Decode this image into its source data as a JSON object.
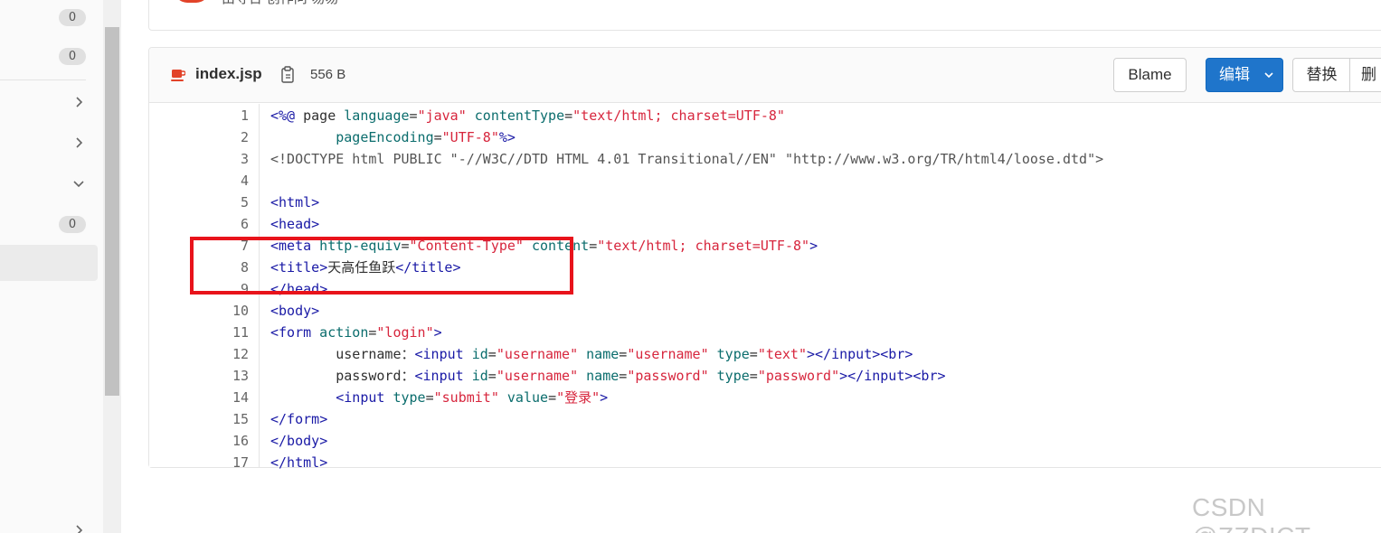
{
  "sidebar": {
    "badges": [
      "0",
      "0",
      "0"
    ],
    "chevrons": [
      "chevron-right",
      "chevron-right",
      "chevron-down",
      "chevron-right"
    ]
  },
  "top_card": {
    "text": "由寻台 创作问 易易"
  },
  "file": {
    "name": "index.jsp",
    "size": "556 B",
    "icon": "java-file-icon"
  },
  "toolbar": {
    "blame_label": "Blame",
    "edit_label": "编辑",
    "replace_label": "替换",
    "delete_label": "删"
  },
  "colors": {
    "accent": "#1f75cb",
    "highlight_box": "#e8131b",
    "file_icon": "#e24329"
  },
  "code": {
    "line_numbers": [
      "1",
      "2",
      "3",
      "4",
      "5",
      "6",
      "7",
      "8",
      "9",
      "10",
      "11",
      "12",
      "13",
      "14",
      "15",
      "16",
      "17"
    ],
    "lines": [
      "<%@ page language=\"java\" contentType=\"text/html; charset=UTF-8\"",
      "        pageEncoding=\"UTF-8\"%>",
      "<!DOCTYPE html PUBLIC \"-//W3C//DTD HTML 4.01 Transitional//EN\" \"http://www.w3.org/TR/html4/loose.dtd\">",
      "",
      "<html>",
      "<head>",
      "<meta http-equiv=\"Content-Type\" content=\"text/html; charset=UTF-8\">",
      "<title>天高任鱼跃</title>",
      "</head>",
      "<body>",
      "<form action=\"login\">",
      "        username：<input id=\"username\" name=\"username\" type=\"text\"></input><br>",
      "        password：<input id=\"username\" name=\"password\" type=\"password\"></input><br>",
      "        <input type=\"submit\" value=\"登录\">",
      "</form>",
      "</body>",
      "</html>"
    ]
  },
  "watermark": "CSDN @ZZDICT"
}
